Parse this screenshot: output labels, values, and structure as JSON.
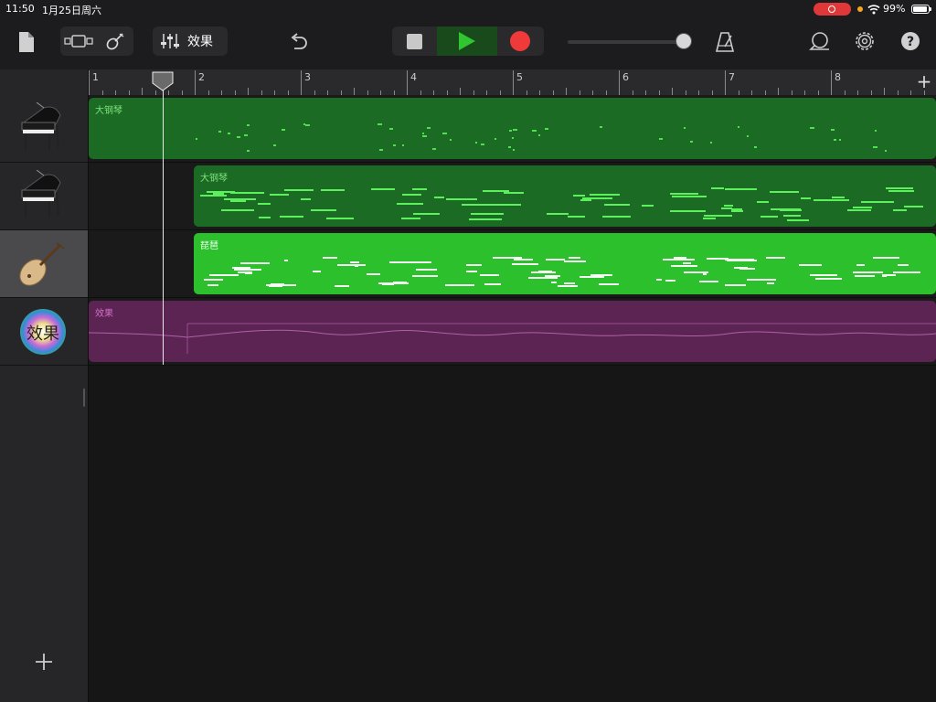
{
  "status": {
    "time": "11:50",
    "date": "1月25日周六",
    "battery": "99%"
  },
  "toolbar": {
    "fx_label": "效果",
    "colors": {
      "play": "#31c531",
      "record": "#f03a3a"
    }
  },
  "ruler": {
    "bars": [
      "1",
      "2",
      "3",
      "4",
      "5",
      "6",
      "7",
      "8"
    ]
  },
  "tracks": [
    {
      "name": "大钢琴",
      "icon": "grand-piano-icon",
      "region_label": "大钢琴"
    },
    {
      "name": "大钢琴",
      "icon": "grand-piano-icon",
      "region_label": "大钢琴"
    },
    {
      "name": "琵琶",
      "icon": "pipa-icon",
      "region_label": "琵琶",
      "selected": true
    },
    {
      "name": "效果",
      "icon": "effects-icon",
      "region_label": "效果",
      "icon_text": "效果"
    }
  ]
}
